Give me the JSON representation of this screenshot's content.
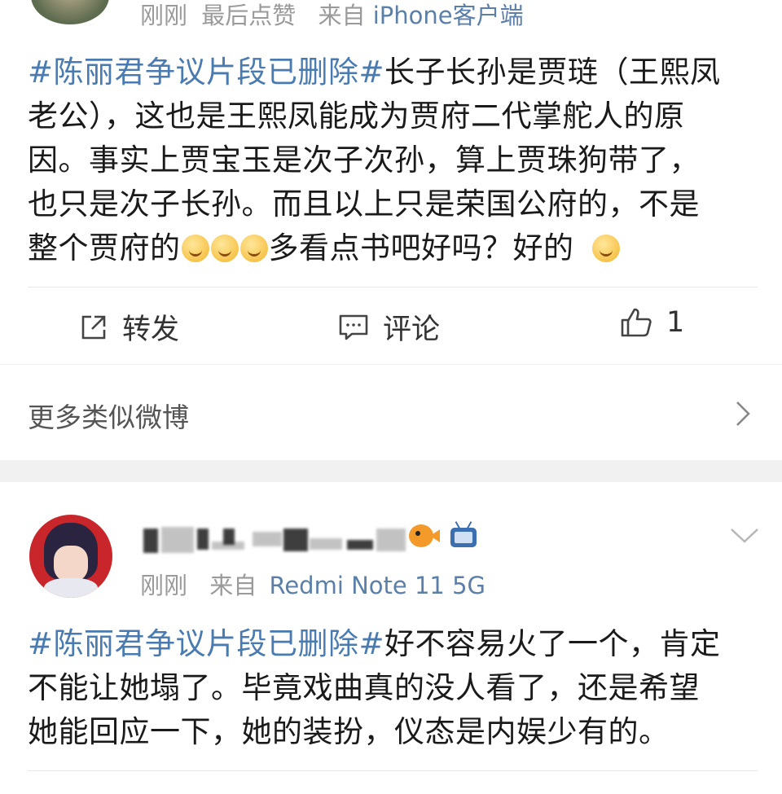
{
  "post1": {
    "meta_time": "刚刚",
    "meta_liked": "最后点赞",
    "meta_from": "来自",
    "meta_source": "iPhone客户端",
    "lines": [
      {
        "topic": "#陈丽君争议片段已删除#",
        "text": "长子长孙是贾琏（王熙凤"
      },
      {
        "topic": "",
        "text": "老公），这也是王熙凤能成为贾府二代掌舵人的原"
      },
      {
        "topic": "",
        "text": "因。事实上贾宝玉是次子次孙，算上贾珠狗带了，"
      },
      {
        "topic": "",
        "text": "也只是次子长孙。而且以上只是荣国公府的，不是"
      },
      {
        "topic": "",
        "text": "整个贾府的"
      }
    ],
    "tail_text": "多看点书吧好吗？好的",
    "emojis": [
      "shush-face-icon",
      "shush-face-icon",
      "shush-face-icon",
      "smile-face-icon"
    ],
    "actions": {
      "repost_label": "转发",
      "comment_label": "评论",
      "like_count": "1"
    }
  },
  "more_similar": {
    "label": "更多类似微博"
  },
  "post2": {
    "meta_time": "刚刚",
    "meta_from": "来自",
    "meta_source": "Redmi Note 11 5G",
    "lines": [
      {
        "topic": "#陈丽君争议片段已删除#",
        "text": "好不容易火了一个，肯定"
      },
      {
        "topic": "",
        "text": "不能让她塌了。毕竟戏曲真的没人看了，还是希望"
      },
      {
        "topic": "",
        "text": "她能回应一下，她的装扮，仪态是内娱少有的。"
      }
    ],
    "badges": [
      "fish-badge-icon",
      "tv-badge-icon"
    ]
  },
  "colors": {
    "topic": "#4a7bb0",
    "source": "#5b7fa8",
    "meta": "#9a9a9a",
    "separator_band": "#f1f1f1"
  }
}
